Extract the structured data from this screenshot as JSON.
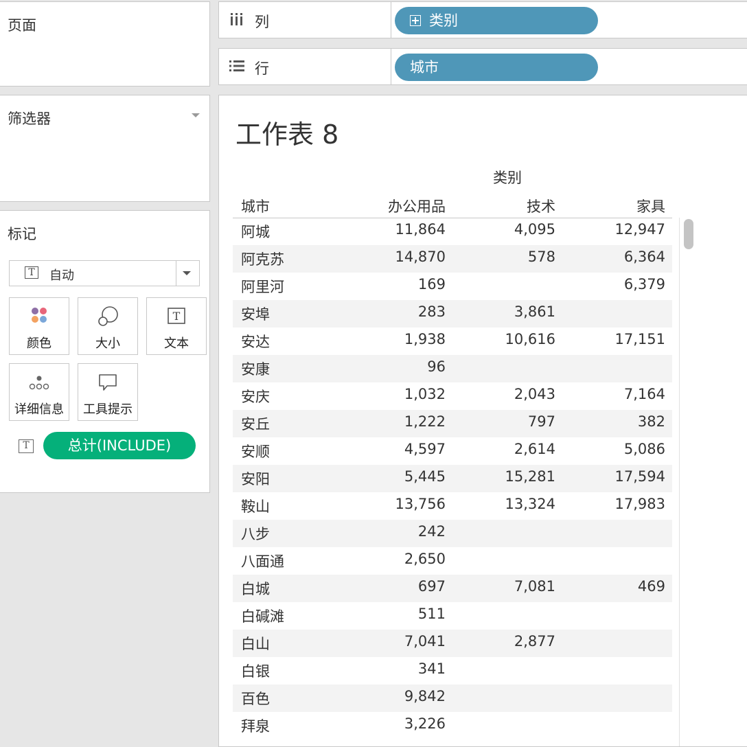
{
  "pages": {
    "title": "页面"
  },
  "filters": {
    "title": "筛选器"
  },
  "marks": {
    "title": "标记",
    "mark_type": "自动",
    "buttons": [
      {
        "label": "颜色",
        "icon": "color-icon"
      },
      {
        "label": "大小",
        "icon": "size-icon"
      },
      {
        "label": "文本",
        "icon": "text-icon"
      },
      {
        "label": "详细信息",
        "icon": "detail-icon"
      },
      {
        "label": "工具提示",
        "icon": "tooltip-icon"
      }
    ],
    "text_field": "总计(INCLUDE)",
    "pill_color": "#05b07a"
  },
  "columns_shelf": {
    "label": "列",
    "pill": "类别",
    "pill_color": "#4f97b8"
  },
  "rows_shelf": {
    "label": "行",
    "pill": "城市",
    "pill_color": "#4f97b8"
  },
  "view": {
    "title": "工作表 8",
    "column_group": "类别",
    "headers": {
      "city": "城市",
      "c1": "办公用品",
      "c2": "技术",
      "c3": "家具"
    },
    "rows": [
      {
        "city": "阿城",
        "c1": "11,864",
        "c2": "4,095",
        "c3": "12,947"
      },
      {
        "city": "阿克苏",
        "c1": "14,870",
        "c2": "578",
        "c3": "6,364"
      },
      {
        "city": "阿里河",
        "c1": "169",
        "c2": "",
        "c3": "6,379"
      },
      {
        "city": "安埠",
        "c1": "283",
        "c2": "3,861",
        "c3": ""
      },
      {
        "city": "安达",
        "c1": "1,938",
        "c2": "10,616",
        "c3": "17,151"
      },
      {
        "city": "安康",
        "c1": "96",
        "c2": "",
        "c3": ""
      },
      {
        "city": "安庆",
        "c1": "1,032",
        "c2": "2,043",
        "c3": "7,164"
      },
      {
        "city": "安丘",
        "c1": "1,222",
        "c2": "797",
        "c3": "382"
      },
      {
        "city": "安顺",
        "c1": "4,597",
        "c2": "2,614",
        "c3": "5,086"
      },
      {
        "city": "安阳",
        "c1": "5,445",
        "c2": "15,281",
        "c3": "17,594"
      },
      {
        "city": "鞍山",
        "c1": "13,756",
        "c2": "13,324",
        "c3": "17,983"
      },
      {
        "city": "八步",
        "c1": "242",
        "c2": "",
        "c3": ""
      },
      {
        "city": "八面通",
        "c1": "2,650",
        "c2": "",
        "c3": ""
      },
      {
        "city": "白城",
        "c1": "697",
        "c2": "7,081",
        "c3": "469"
      },
      {
        "city": "白碱滩",
        "c1": "511",
        "c2": "",
        "c3": ""
      },
      {
        "city": "白山",
        "c1": "7,041",
        "c2": "2,877",
        "c3": ""
      },
      {
        "city": "白银",
        "c1": "341",
        "c2": "",
        "c3": ""
      },
      {
        "city": "百色",
        "c1": "9,842",
        "c2": "",
        "c3": ""
      },
      {
        "city": "拜泉",
        "c1": "3,226",
        "c2": "",
        "c3": ""
      }
    ]
  }
}
